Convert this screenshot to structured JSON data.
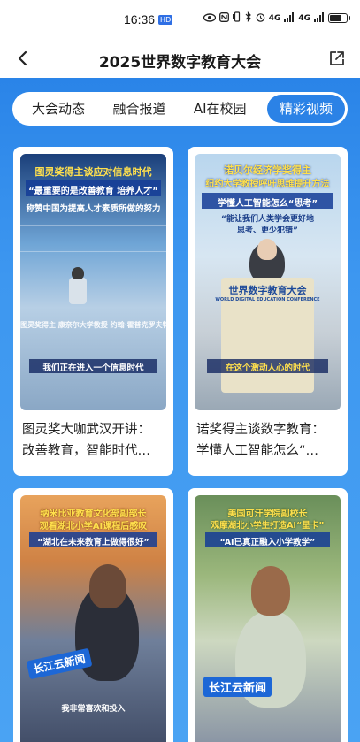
{
  "status_bar": {
    "time": "16:36",
    "hd_badge": "HD",
    "net_1": "4G",
    "net_2": "4G",
    "battery_level": 0.75
  },
  "header": {
    "title": "2025世界数字教育大会",
    "back_icon": "chevron-left-icon",
    "share_icon": "share-icon"
  },
  "tabs": [
    {
      "label": "大会动态",
      "active": false
    },
    {
      "label": "融合报道",
      "active": false
    },
    {
      "label": "AI在校园",
      "active": false
    },
    {
      "label": "精彩视频",
      "active": true
    }
  ],
  "cards": [
    {
      "title_line1": "图灵奖大咖武汉开讲：",
      "title_line2": "改善教育，智能时代…",
      "overlay": {
        "headline1": "图灵奖得主谈应对信息时代",
        "headline2": "“最重要的是改善教育 培养人才”",
        "headline3": "称赞中国为提高人才素质所做的努力",
        "caption1": "图灵奖得主 康奈尔大学教授 约翰·霍普克罗夫特",
        "caption2": "我们正在进入一个信息时代"
      }
    },
    {
      "title_line1": "诺奖得主谈数字教育：",
      "title_line2": "学懂人工智能怎么“…",
      "overlay": {
        "headline1": "诺贝尔经济学奖得主",
        "headline2": "纽约大学教授呼吁思维提升方法",
        "headline3": "学懂人工智能怎么“思考”",
        "quote": "“能让我们人类学会更好地思考、更少犯错”",
        "podium": "世界数字教育大会",
        "podium_en": "WORLD DIGITAL EDUCATION CONFERENCE",
        "caption": "在这个激动人心的时代"
      }
    },
    {
      "title_line1": "",
      "title_line2": "",
      "overlay": {
        "headline1": "纳米比亚教育文化部副部长",
        "headline2": "观看湖北小学AI课程后感叹",
        "headline3": "“湖北在未来教育上做得很好”",
        "logo": "长江云新闻",
        "caption": "我非常喜欢和投入"
      }
    },
    {
      "title_line1": "",
      "title_line2": "",
      "overlay": {
        "headline1": "美国可汗学院副校长",
        "headline2": "观摩湖北小学生打造AI“星卡”",
        "headline3": "“AI已真正融入小学教学”",
        "logo": "长江云新闻"
      }
    }
  ],
  "colors": {
    "accent": "#2b82e6",
    "background_top": "#2a84e8",
    "background_bottom": "#4aa3f3"
  }
}
